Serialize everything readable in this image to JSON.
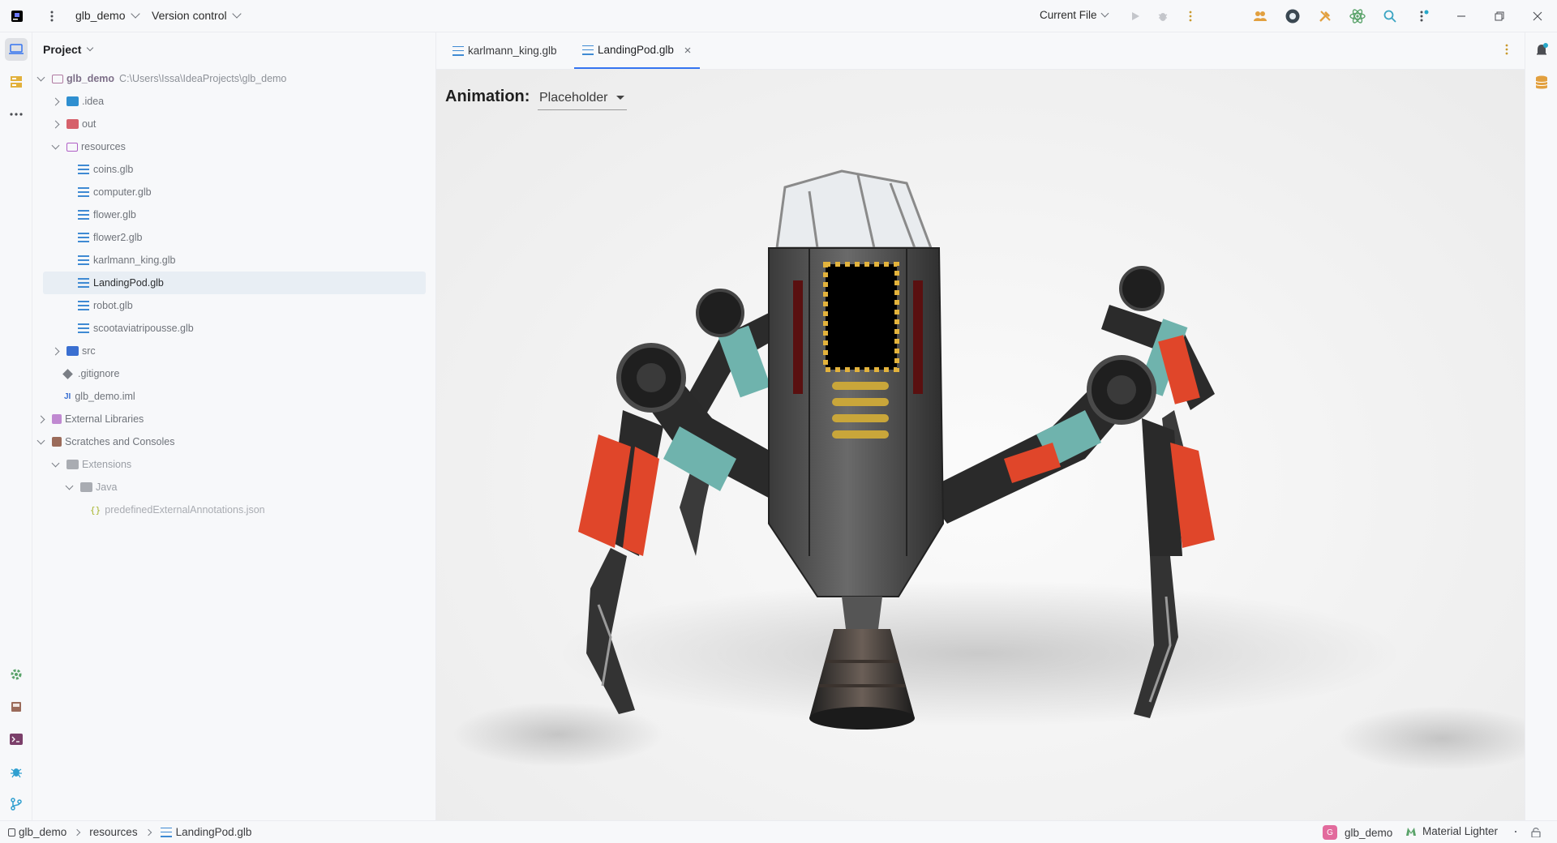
{
  "titlebar": {
    "project_name": "glb_demo",
    "vcs_label": "Version control",
    "run_config": "Current File"
  },
  "project_panel": {
    "title": "Project",
    "root_name": "glb_demo",
    "root_path": "C:\\Users\\Issa\\IdeaProjects\\glb_demo",
    "items": {
      "idea": ".idea",
      "out": "out",
      "resources": "resources",
      "coins": "coins.glb",
      "computer": "computer.glb",
      "flower": "flower.glb",
      "flower2": "flower2.glb",
      "karlmann": "karlmann_king.glb",
      "landingpod": "LandingPod.glb",
      "robot": "robot.glb",
      "scoot": "scootaviatripousse.glb",
      "src": "src",
      "gitignore": ".gitignore",
      "iml": "glb_demo.iml",
      "external_libraries": "External Libraries",
      "scratches": "Scratches and Consoles",
      "extensions": "Extensions",
      "java": "Java",
      "annotations": "predefinedExternalAnnotations.json"
    }
  },
  "tabs": [
    {
      "label": "karlmann_king.glb",
      "active": false
    },
    {
      "label": "LandingPod.glb",
      "active": true
    }
  ],
  "viewer": {
    "animation_label": "Animation:",
    "animation_selected": "Placeholder"
  },
  "statusbar": {
    "crumbs": [
      "glb_demo",
      "resources",
      "LandingPod.glb"
    ],
    "project_badge_letter": "G",
    "project_name": "glb_demo",
    "theme": "Material Lighter"
  },
  "colors": {
    "accent": "#3574f0",
    "selection": "#e8eef4",
    "glb_icon": "#3f8ad3",
    "leg_orange": "#e0462a",
    "leg_teal": "#6fb3ad"
  }
}
